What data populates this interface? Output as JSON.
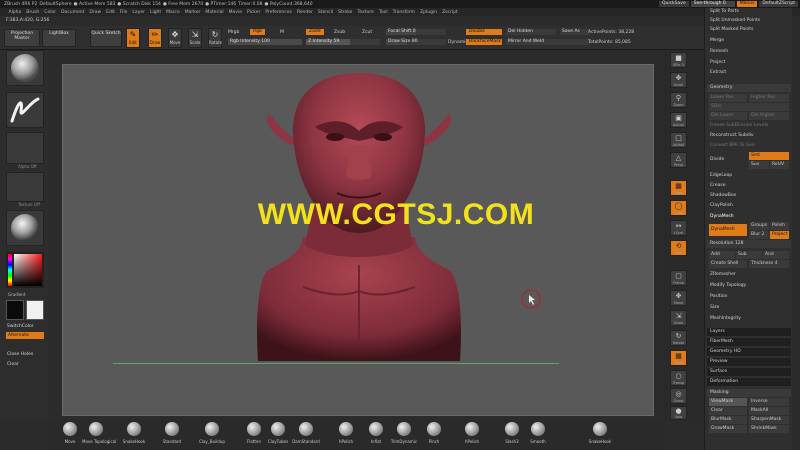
{
  "titlebar": {
    "items": [
      "ZBrush 4R6 P2",
      "DefaultSphere",
      "● Active Mem 583",
      "● Scratch Disk 154",
      "● Free Mem 2670",
      "● PTimer:146",
      "Timer:0.08",
      "● PolyCount:368,640"
    ],
    "quicksave": "QuickSave",
    "seethrough": "See-through 0",
    "menus": "Menus",
    "script": "DefaultZScript"
  },
  "menubar": [
    "Alpha",
    "Brush",
    "Color",
    "Document",
    "Draw",
    "Edit",
    "File",
    "Layer",
    "Light",
    "Macro",
    "Marker",
    "Material",
    "Movie",
    "Picker",
    "Preferences",
    "Render",
    "Stencil",
    "Stroke",
    "Texture",
    "Tool",
    "Transform",
    "Zplugin",
    "Zscript"
  ],
  "status": "F:383,A:420, G:256",
  "toolbar": {
    "projection_master": "Projection Master",
    "lightbox": "LightBox",
    "quick_sketch": "Quick Sketch",
    "edit": "Edit",
    "draw": "Draw",
    "move": "Move",
    "scale": "Scale",
    "rotate": "Rotate",
    "mrgb": "Mrgb",
    "rgb": "Rgb",
    "m": "M",
    "zadd": "Zadd",
    "zsub": "Zsub",
    "zcut": "Zcut",
    "rgb_intensity": "Rgb Intensity 100",
    "z_intensity": "Z Intensity 59",
    "focal_shift": "Focal Shift 0",
    "draw_size": "Draw Size 80",
    "dynamic": "Dynamic",
    "double": "Double",
    "backfacemask": "BackfaceMask",
    "del_hidden": "Del Hidden",
    "save_as": "Save As",
    "mirror_weld": "Mirror And Weld",
    "active_points": "ActivePoints: 38,228",
    "total_points": "TotalPoints: 85,085"
  },
  "leftshelf": {
    "alpha_off": "Alpha Off",
    "texture_off": "Texture Off",
    "gradient": "Gradient",
    "switchcolor": "SwitchColor",
    "alternate": "Alternate",
    "close_holes": "Close Holes",
    "clear": "Clear"
  },
  "watermark": "WWW.CGTSJ.COM",
  "rightdock": [
    "SPix 3",
    "Scroll",
    "Zoom",
    "Actual",
    "AAHalf",
    "Persp",
    "Floor",
    "Local",
    "LSym",
    "Xyz",
    "Frame",
    "Move",
    "Scale",
    "Rotate",
    "PolyF",
    "Transp",
    "Ghost",
    "Solo",
    "Xpose"
  ],
  "rightpanel": {
    "items": [
      "Split To Parts",
      "Split Unmasked Points",
      "Split Masked Points",
      "Merge",
      "Remesh",
      "Project",
      "Extract"
    ],
    "geometry": "Geometry",
    "lower_res": "Lower Res",
    "higher_res": "Higher Res",
    "sdiv": "SDiv",
    "del_lower": "Del Lower",
    "del_higher": "Del Higher",
    "freeze_subdiv": "Freeze SubDivision Levels",
    "reconstruct_subdiv": "Reconstruct Subdiv",
    "convert_bpr": "Convert BPR To Geo",
    "divide": "Divide",
    "smt": "Smt",
    "suv": "Suv",
    "rsuv": "ReUV",
    "edgeloop": "EdgeLoop",
    "crease": "Crease",
    "shadowbox": "ShadowBox",
    "claypolish": "ClayPolish",
    "dynamesh_hdr": "DynaMesh",
    "dynamesh_btn": "DynaMesh",
    "groups": "Groups",
    "polish": "Polish",
    "blur": "Blur 2",
    "project": "Project",
    "resolution": "Resolution 128",
    "add": "Add",
    "sub": "Sub",
    "and": "And",
    "create_shell": "Create Shell",
    "thickness": "Thickness 4",
    "zremesher": "ZRemesher",
    "modify_topology": "Modify Topology",
    "position": "Position",
    "size": "Size",
    "meshintegrity": "MeshIntegrity",
    "lower": [
      "Layers",
      "FiberMesh",
      "Geometry HD",
      "Preview",
      "Surface",
      "Deformation"
    ],
    "masking": "Masking",
    "viewmask": "ViewMask",
    "inverse": "Inverse",
    "clear": "Clear",
    "maskall": "MaskAll",
    "blurmask": "BlurMask",
    "sharpenmask": "SharpenMask",
    "growmask": "GrowMask",
    "shrinkmask": "ShrinkMask"
  },
  "brushes": [
    "Move",
    "Move Topological",
    "SnakeHook",
    "Standard",
    "Clay_Buildup",
    "Flatten",
    "ClayTubes",
    "DamStandard",
    "hPolish",
    "Inflat",
    "TrimDynamic",
    "Pinch",
    "hPolish",
    "Slash3",
    "Smooth",
    "SnakeHook"
  ]
}
